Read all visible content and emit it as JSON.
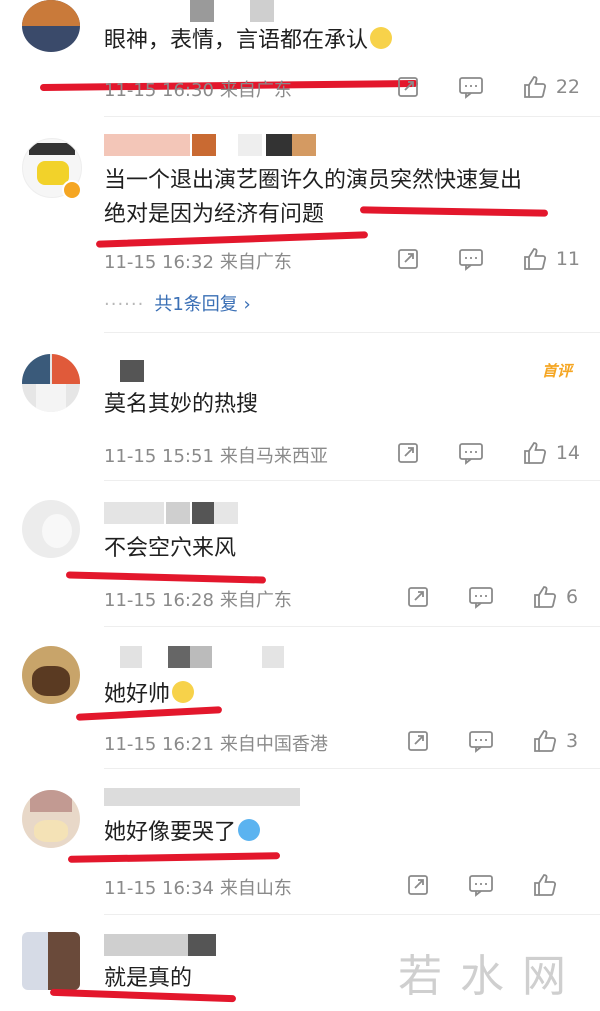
{
  "comments": [
    {
      "text": "眼神，表情，言语都在承认",
      "time": "11-15 16:30",
      "location": "来自广东",
      "likes": "22",
      "has_emoji": true
    },
    {
      "text_line1": "当一个退出演艺圈许久的演员突然快速复出",
      "text_line2": "绝对是因为经济有问题",
      "time": "11-15 16:32",
      "location": "来自广东",
      "likes": "11",
      "replies_label": "共1条回复",
      "replies_dots": "······",
      "replies_chevron": "›"
    },
    {
      "badge": "首评",
      "text": "莫名其妙的热搜",
      "time": "11-15 15:51",
      "location": "来自马来西亚",
      "likes": "14"
    },
    {
      "text": "不会空穴来风",
      "time": "11-15 16:28",
      "location": "来自广东",
      "likes": "6"
    },
    {
      "text": "她好帅",
      "time": "11-15 16:21",
      "location": "来自中国香港",
      "likes": "3",
      "has_emoji": true
    },
    {
      "text": "她好像要哭了",
      "time": "11-15 16:34",
      "location": "来自山东",
      "likes": "",
      "has_emoji": true
    },
    {
      "text": "就是真的"
    }
  ],
  "watermark": "若水网",
  "colors": {
    "underline": "#e3172c",
    "link": "#3a6fb5",
    "meta": "#8a8a8a",
    "badge": "#f5a623"
  },
  "icons": [
    "share-icon",
    "comment-icon",
    "like-icon"
  ]
}
